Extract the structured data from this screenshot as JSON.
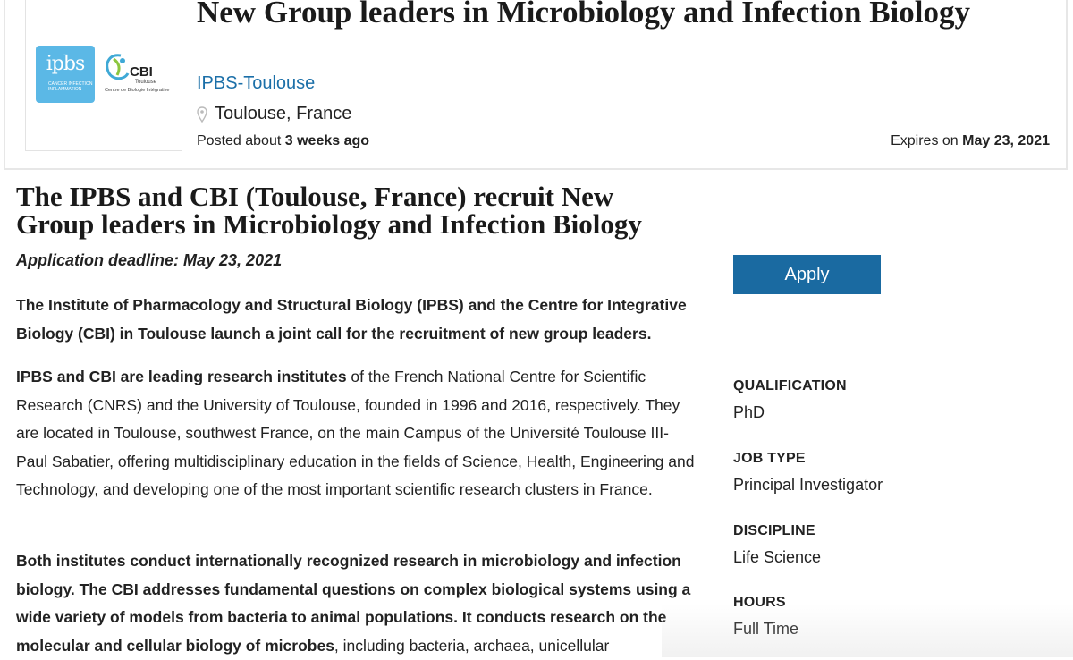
{
  "header": {
    "title": "New Group leaders in Microbiology and Infection Biology",
    "employer": "IPBS-Toulouse",
    "location": "Toulouse, France",
    "posted_prefix": "Posted about",
    "posted_value": "3 weeks ago",
    "expires_prefix": "Expires on",
    "expires_value": "May 23, 2021",
    "logos": {
      "ipbs": {
        "word": "ipbs",
        "sub": "CANCER INFECTION INFLAMMATION",
        "color": "#5bb8e6"
      },
      "cbi": {
        "word": "CBI",
        "sub1": "Toulouse",
        "sub2": "Centre de Biologie Intégrative",
        "color": "#3fa9d6"
      }
    }
  },
  "article": {
    "heading": "The IPBS and CBI (Toulouse, France) recruit New Group leaders in Microbiology and Infection Biology",
    "deadline": "Application deadline: May 23, 2021",
    "p1": "The Institute of Pharmacology and Structural Biology (IPBS) and the Centre for Integrative Biology (CBI) in Toulouse launch a joint call for the recruitment of new group leaders.",
    "p2_bold": "IPBS and CBI are leading research institutes",
    "p2_rest": " of the French National Centre for Scientific Research (CNRS) and the University of Toulouse, founded in 1996 and 2016, respectively. They are located in Toulouse, southwest France, on the main Campus of the Université Toulouse III-Paul Sabatier, offering multidisciplinary education in the fields of Science, Health, Engineering and Technology, and developing one of the most important scientific research clusters in France.",
    "p3_bold": "Both institutes conduct internationally recognized research in microbiology and infection biology. The CBI addresses fundamental questions on complex biological systems using a wide variety of models from bacteria to animal populations. It conducts research on the molecular and cellular biology of microbes",
    "p3_rest": ", including bacteria, archaea, unicellular"
  },
  "sidebar": {
    "apply_label": "Apply",
    "apply_color": "#1a6aa1",
    "qualification_label": "QUALIFICATION",
    "qualification_value": "PhD",
    "job_type_label": "JOB TYPE",
    "job_type_value": "Principal Investigator",
    "discipline_label": "DISCIPLINE",
    "discipline_value": "Life Science",
    "hours_label": "HOURS",
    "hours_value": "Full Time"
  },
  "icons": {
    "location": "map-pin-icon"
  }
}
